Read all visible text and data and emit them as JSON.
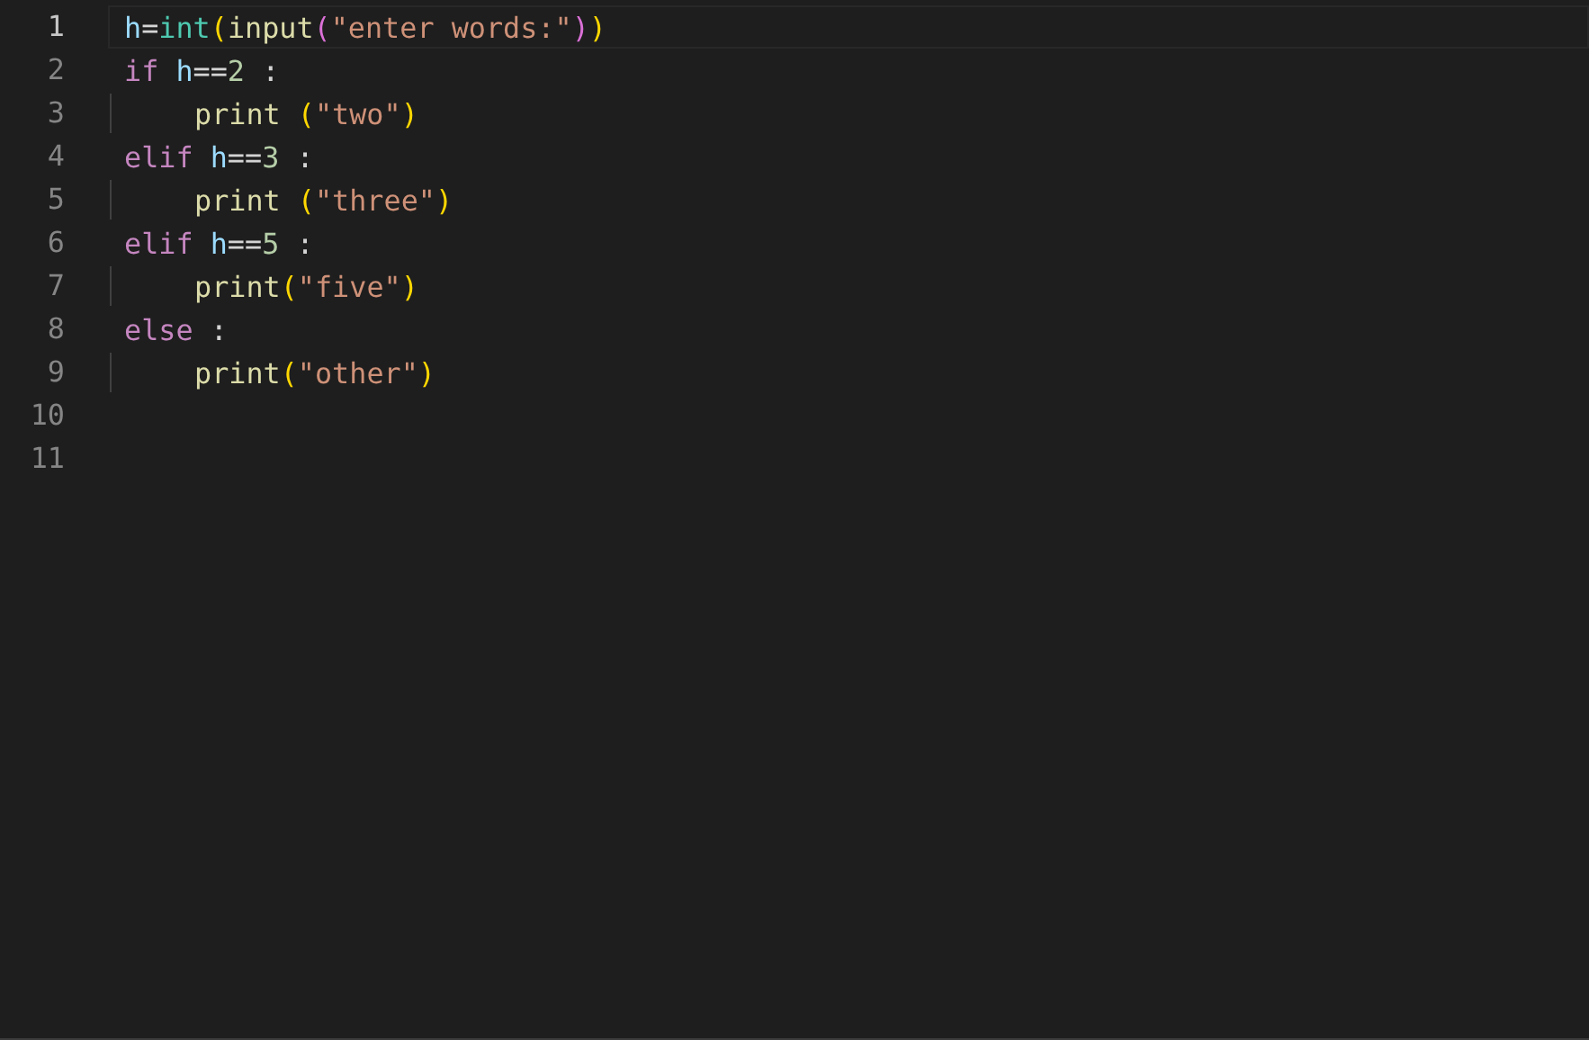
{
  "editor": {
    "lines": [
      {
        "number": "1",
        "current": true,
        "indented": false,
        "tokens": [
          {
            "kind": "var",
            "text": "h"
          },
          {
            "kind": "op",
            "text": "="
          },
          {
            "kind": "builtin",
            "text": "int"
          },
          {
            "kind": "b1",
            "text": "("
          },
          {
            "kind": "func",
            "text": "input"
          },
          {
            "kind": "b2",
            "text": "("
          },
          {
            "kind": "str",
            "text": "\"enter words:\""
          },
          {
            "kind": "b2",
            "text": ")"
          },
          {
            "kind": "b1",
            "text": ")"
          }
        ]
      },
      {
        "number": "2",
        "current": false,
        "indented": false,
        "tokens": [
          {
            "kind": "kw",
            "text": "if"
          },
          {
            "kind": "var",
            "text": " h"
          },
          {
            "kind": "op",
            "text": "=="
          },
          {
            "kind": "num",
            "text": "2"
          },
          {
            "kind": "op",
            "text": " :"
          }
        ]
      },
      {
        "number": "3",
        "current": false,
        "indented": true,
        "tokens": [
          {
            "kind": "func",
            "text": "print"
          },
          {
            "kind": "b1",
            "text": " ("
          },
          {
            "kind": "str",
            "text": "\"two\""
          },
          {
            "kind": "b1",
            "text": ")"
          }
        ]
      },
      {
        "number": "4",
        "current": false,
        "indented": false,
        "tokens": [
          {
            "kind": "kw",
            "text": "elif"
          },
          {
            "kind": "var",
            "text": " h"
          },
          {
            "kind": "op",
            "text": "=="
          },
          {
            "kind": "num",
            "text": "3"
          },
          {
            "kind": "op",
            "text": " :"
          }
        ]
      },
      {
        "number": "5",
        "current": false,
        "indented": true,
        "tokens": [
          {
            "kind": "func",
            "text": "print"
          },
          {
            "kind": "b1",
            "text": " ("
          },
          {
            "kind": "str",
            "text": "\"three\""
          },
          {
            "kind": "b1",
            "text": ")"
          }
        ]
      },
      {
        "number": "6",
        "current": false,
        "indented": false,
        "tokens": [
          {
            "kind": "kw",
            "text": "elif"
          },
          {
            "kind": "var",
            "text": " h"
          },
          {
            "kind": "op",
            "text": "=="
          },
          {
            "kind": "num",
            "text": "5"
          },
          {
            "kind": "op",
            "text": " :"
          }
        ]
      },
      {
        "number": "7",
        "current": false,
        "indented": true,
        "tokens": [
          {
            "kind": "func",
            "text": "print"
          },
          {
            "kind": "b1",
            "text": "("
          },
          {
            "kind": "str",
            "text": "\"five\""
          },
          {
            "kind": "b1",
            "text": ")"
          }
        ]
      },
      {
        "number": "8",
        "current": false,
        "indented": false,
        "tokens": [
          {
            "kind": "kw",
            "text": "else"
          },
          {
            "kind": "op",
            "text": " :"
          }
        ]
      },
      {
        "number": "9",
        "current": false,
        "indented": true,
        "tokens": [
          {
            "kind": "func",
            "text": "print"
          },
          {
            "kind": "b1",
            "text": "("
          },
          {
            "kind": "str",
            "text": "\"other\""
          },
          {
            "kind": "b1",
            "text": ")"
          }
        ]
      },
      {
        "number": "10",
        "current": false,
        "indented": false
      },
      {
        "number": "11",
        "current": false,
        "indented": false
      }
    ]
  }
}
